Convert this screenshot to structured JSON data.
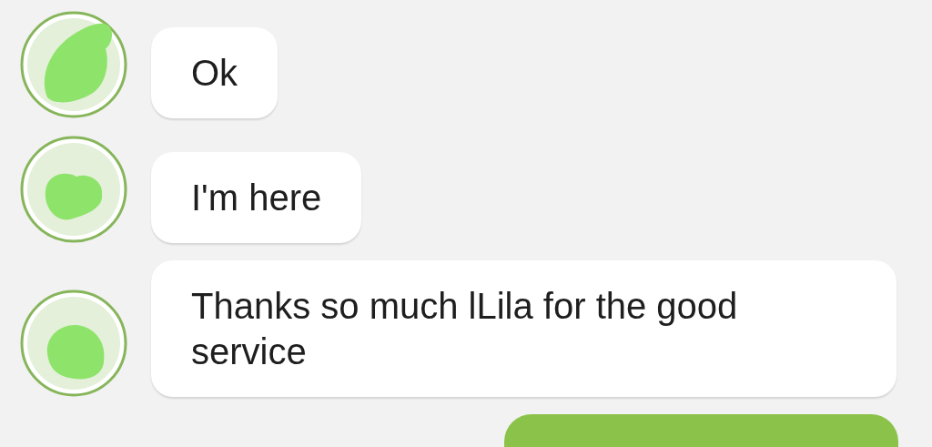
{
  "messages": [
    {
      "kind": "incoming",
      "text": "Ok"
    },
    {
      "kind": "incoming",
      "text": "I'm here"
    },
    {
      "kind": "incoming",
      "text": "Thanks so much lLila for the good service"
    },
    {
      "kind": "outgoing"
    }
  ]
}
